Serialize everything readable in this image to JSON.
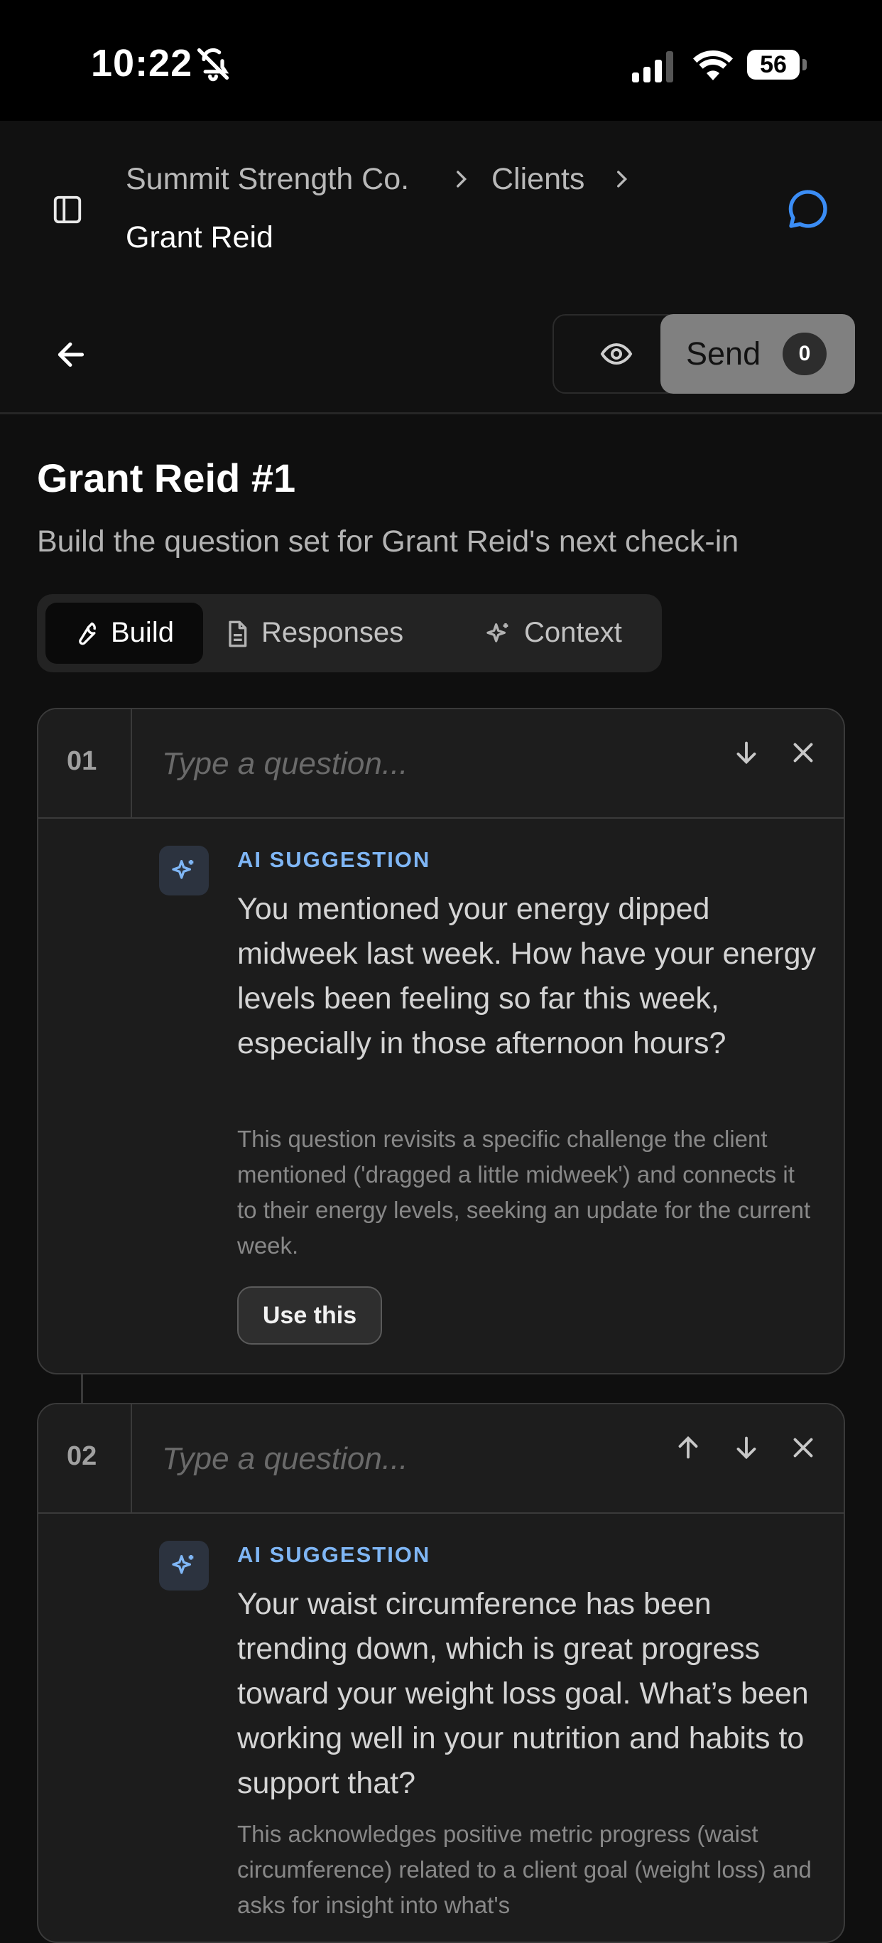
{
  "status_bar": {
    "time": "10:22",
    "battery": "56"
  },
  "breadcrumb": {
    "items": [
      "Summit Strength Co.",
      "Clients"
    ],
    "current": "Grant Reid"
  },
  "toolbar": {
    "send_label": "Send",
    "send_count": "0"
  },
  "page": {
    "title": "Grant Reid #1",
    "subtitle": "Build the question set for Grant Reid's next check-in"
  },
  "tabs": [
    {
      "label": "Build",
      "active": true
    },
    {
      "label": "Responses",
      "active": false
    },
    {
      "label": "Context",
      "active": false
    }
  ],
  "questions": [
    {
      "number": "01",
      "placeholder": "Type a question...",
      "suggestion_label": "AI SUGGESTION",
      "suggestion": "You mentioned your energy dipped midweek last week. How have your energy levels been feeling so far this week, especially in those afternoon hours?",
      "reason": "This question revisits a specific challenge the client mentioned ('dragged a little midweek') and connects it to their energy levels, seeking an update for the current week.",
      "use_label": "Use this"
    },
    {
      "number": "02",
      "placeholder": "Type a question...",
      "suggestion_label": "AI SUGGESTION",
      "suggestion": "Your waist circumference has been trending down, which is great progress toward your weight loss goal. What’s been working well in your nutrition and habits to support that?",
      "reason": "This acknowledges positive metric progress (waist circumference) related to a client goal (weight loss) and asks for insight into what's"
    }
  ],
  "colors": {
    "accent": "#3b8df5",
    "ai_label": "#7fb6f5",
    "background": "#0f0f0f"
  },
  "icons": {
    "sidebar": "sidebar-toggle-icon",
    "chat": "chat-bubble-icon",
    "back": "arrow-left-icon",
    "preview": "eye-icon",
    "build": "wrench-icon",
    "responses": "document-icon",
    "context": "sparkle-icon"
  }
}
